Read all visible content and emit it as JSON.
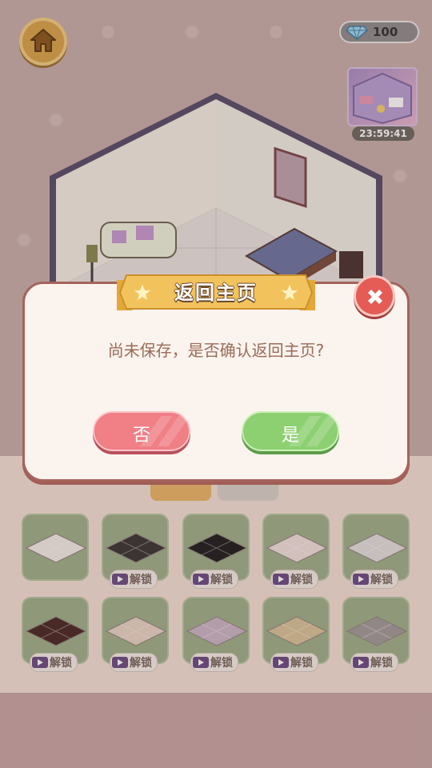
{
  "hud": {
    "gem_count": "100",
    "timer": "23:59:41",
    "home_icon": "home-icon",
    "gem_icon": "diamond-icon"
  },
  "dialog": {
    "title": "返回主页",
    "message": "尚未保存，是否确认返回主页?",
    "no_label": "否",
    "yes_label": "是",
    "close_icon": "close-icon",
    "colors": {
      "no": "#f07f86",
      "yes": "#8dd071",
      "frame": "#a5635b",
      "ribbon": "#f2c35d"
    }
  },
  "catalog": {
    "unlock_label": "解锁",
    "rows": [
      [
        {
          "swatch": "#f3eeea",
          "locked": false
        },
        {
          "swatch": "#3a3735",
          "locked": true
        },
        {
          "swatch": "#1f1f1f",
          "locked": true
        },
        {
          "swatch": "#f1e2df",
          "locked": true
        },
        {
          "swatch": "#e3e1e0",
          "locked": true
        }
      ],
      [
        {
          "swatch": "#4a2a27",
          "locked": true
        },
        {
          "swatch": "#e8d6c6",
          "locked": true
        },
        {
          "swatch": "#cbb7c8",
          "locked": true
        },
        {
          "swatch": "#d9c59a",
          "locked": true
        },
        {
          "swatch": "#a19d9c",
          "locked": true
        }
      ]
    ]
  }
}
